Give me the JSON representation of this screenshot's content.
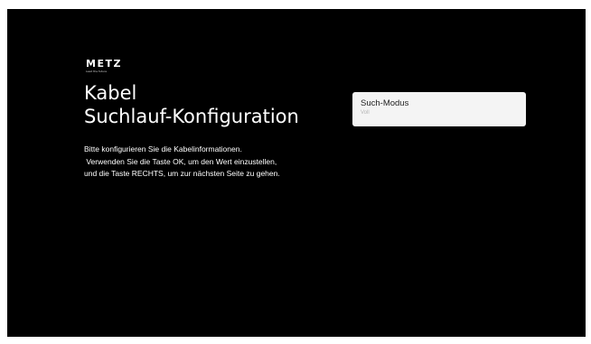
{
  "brand": {
    "name": "METZ",
    "tagline": "Lead the future"
  },
  "header": {
    "title_line1": "Kabel",
    "title_line2": "Suchlauf-Konfiguration"
  },
  "description": {
    "line1": "Bitte konfigurieren Sie die Kabelinformationen.",
    "line2": " Verwenden Sie die Taste OK, um den Wert einzustellen,",
    "line3": "und die Taste RECHTS, um zur nächsten Seite zu gehen."
  },
  "settings": {
    "items": [
      {
        "label": "Such-Modus",
        "value": "Voll"
      }
    ]
  },
  "colors": {
    "background": "#000000",
    "text": "#ffffff",
    "item_background": "#f4f4f4",
    "item_label": "#222222",
    "item_value": "#b5b5b5"
  }
}
